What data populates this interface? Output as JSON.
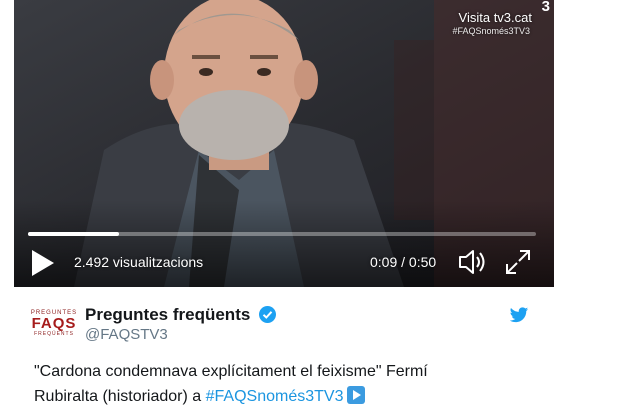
{
  "video": {
    "brand_link": "Visita tv3.cat",
    "brand_hashtag": "#FAQSnomés3TV3",
    "tv3_logo": "3",
    "views": "2.492 visualitzacions",
    "time": "0:09 / 0:50",
    "progress_fraction": 0.18
  },
  "tweet": {
    "avatar_top": "PREGUNTES",
    "avatar_main": "FAQS",
    "avatar_bottom": "FREQÜENTS",
    "display_name": "Preguntes freqüents",
    "username": "@FAQSTV3",
    "text_main": "\"Cardona condemnava explícitament el feixisme\" Fermí Rubiralta (historiador) a ",
    "hashtag": "#FAQSnomés3TV3",
    "colors": {
      "link": "#1b95e0",
      "verified": "#1da1f2",
      "twitter": "#1da1f2"
    }
  }
}
